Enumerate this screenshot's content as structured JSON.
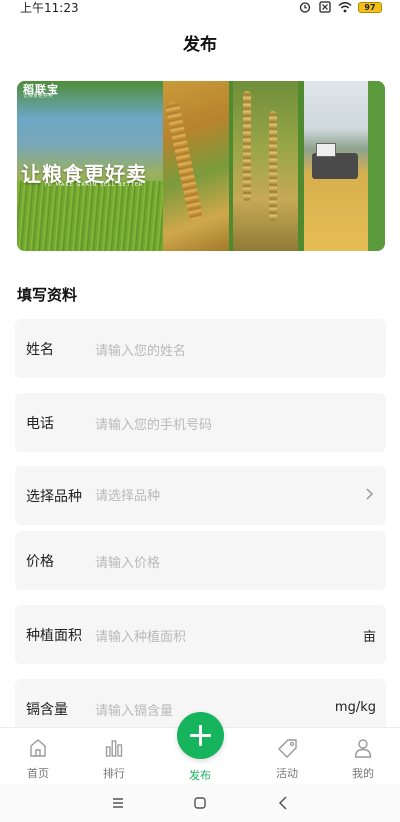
{
  "status_bar": {
    "time": "上午11:23",
    "battery": "97"
  },
  "header": {
    "title": "发布"
  },
  "banner": {
    "logo": "稻联宝",
    "logo_sub": "让粮食更好卖",
    "slogan": "让粮食更好卖",
    "slogan_en": "TO MAKE GRAIN SELL BETTER"
  },
  "form": {
    "section_title": "填写资料",
    "rows": [
      {
        "label": "姓名",
        "placeholder": "请输入您的姓名"
      },
      {
        "label": "电话",
        "placeholder": "请输入您的手机号码"
      },
      {
        "label": "选择品种",
        "placeholder": "请选择品种"
      },
      {
        "label": "价格",
        "placeholder": "请输入价格"
      },
      {
        "label": "种植面积",
        "placeholder": "请输入种植面积",
        "unit": "亩"
      },
      {
        "label": "镉含量",
        "placeholder": "请输入镉含量",
        "unit": "mg/kg"
      }
    ]
  },
  "bottom_nav": {
    "items": [
      {
        "label": "首页",
        "icon": "home-icon"
      },
      {
        "label": "排行",
        "icon": "ranking-icon"
      },
      {
        "label": "发布",
        "icon": "plus-icon",
        "active": true
      },
      {
        "label": "活动",
        "icon": "tag-icon"
      },
      {
        "label": "我的",
        "icon": "user-icon"
      }
    ],
    "active_color": "#16b45c"
  }
}
